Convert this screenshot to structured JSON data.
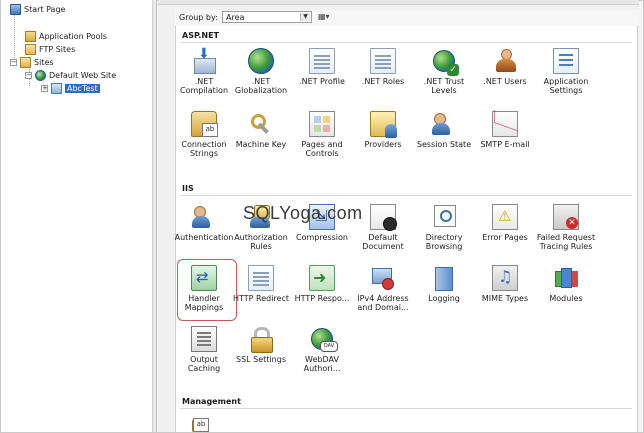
{
  "tree": {
    "start_page": "Start Page",
    "application_pools": "Application Pools",
    "ftp_sites": "FTP Sites",
    "sites": "Sites",
    "default_web_site": "Default Web Site",
    "abctest": "AbcTest"
  },
  "toolbar": {
    "group_by_label": "Group by:",
    "group_by_value": "Area"
  },
  "watermark": "SQLYoga.com",
  "sections": {
    "aspnet": "ASP.NET",
    "iis": "IIS",
    "management": "Management"
  },
  "aspnet_items": [
    {
      "label": ".NET Compilation",
      "icon": "compilation-icon"
    },
    {
      "label": ".NET Globalization",
      "icon": "globalization-icon"
    },
    {
      "label": ".NET Profile",
      "icon": "profile-icon"
    },
    {
      "label": ".NET Roles",
      "icon": "roles-icon"
    },
    {
      "label": ".NET Trust Levels",
      "icon": "trust-levels-icon"
    },
    {
      "label": ".NET Users",
      "icon": "users-icon"
    },
    {
      "label": "Application Settings",
      "icon": "application-settings-icon"
    },
    {
      "label": "Connection Strings",
      "icon": "connection-strings-icon"
    },
    {
      "label": "Machine Key",
      "icon": "machine-key-icon"
    },
    {
      "label": "Pages and Controls",
      "icon": "pages-controls-icon"
    },
    {
      "label": "Providers",
      "icon": "providers-icon"
    },
    {
      "label": "Session State",
      "icon": "session-state-icon"
    },
    {
      "label": "SMTP E-mail",
      "icon": "smtp-email-icon"
    }
  ],
  "iis_items": [
    {
      "label": "Authentication",
      "icon": "authentication-icon"
    },
    {
      "label": "Authorization Rules",
      "icon": "authorization-rules-icon"
    },
    {
      "label": "Compression",
      "icon": "compression-icon"
    },
    {
      "label": "Default Document",
      "icon": "default-document-icon"
    },
    {
      "label": "Directory Browsing",
      "icon": "directory-browsing-icon"
    },
    {
      "label": "Error Pages",
      "icon": "error-pages-icon"
    },
    {
      "label": "Failed Request Tracing Rules",
      "icon": "failed-request-tracing-icon"
    },
    {
      "label": "Handler Mappings",
      "icon": "handler-mappings-icon"
    },
    {
      "label": "HTTP Redirect",
      "icon": "http-redirect-icon"
    },
    {
      "label": "HTTP Respo...",
      "icon": "http-response-headers-icon"
    },
    {
      "label": "IPv4 Address and Domai...",
      "icon": "ipv4-address-icon"
    },
    {
      "label": "Logging",
      "icon": "logging-icon"
    },
    {
      "label": "MIME Types",
      "icon": "mime-types-icon"
    },
    {
      "label": "Modules",
      "icon": "modules-icon"
    },
    {
      "label": "Output Caching",
      "icon": "output-caching-icon"
    },
    {
      "label": "SSL Settings",
      "icon": "ssl-settings-icon"
    },
    {
      "label": "WebDAV Authori...",
      "icon": "webdav-authoring-icon"
    }
  ],
  "colors": {
    "selected_tree_item": "#3169c6",
    "highlight_border": "#c45a5a"
  }
}
